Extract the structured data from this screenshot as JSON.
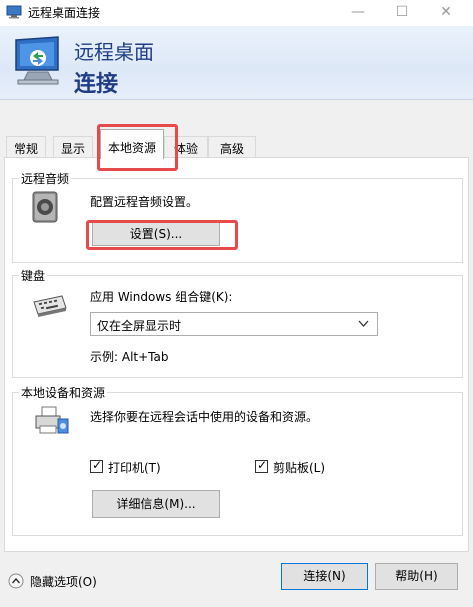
{
  "window": {
    "title": "远程桌面连接",
    "minimize": "—",
    "maximize": "☐",
    "close": "✕"
  },
  "banner": {
    "line1": "远程桌面",
    "line2": "连接"
  },
  "tabs": [
    {
      "label": "常规"
    },
    {
      "label": "显示"
    },
    {
      "label": "本地资源",
      "active": true
    },
    {
      "label": "体验"
    },
    {
      "label": "高级"
    }
  ],
  "audio": {
    "title": "远程音频",
    "description": "配置远程音频设置。",
    "settings_button": "设置(S)..."
  },
  "keyboard": {
    "title": "键盘",
    "label": "应用 Windows 组合键(K):",
    "selected": "仅在全屏显示时",
    "example": "示例: Alt+Tab"
  },
  "devices": {
    "title": "本地设备和资源",
    "description": "选择你要在远程会话中使用的设备和资源。",
    "printer_label": "打印机(T)",
    "printer_checked": true,
    "clipboard_label": "剪贴板(L)",
    "clipboard_checked": true,
    "details_button": "详细信息(M)..."
  },
  "footer": {
    "hide_options": "隐藏选项(O)",
    "connect": "连接(N)",
    "help": "帮助(H)"
  },
  "colors": {
    "highlight": "#e64a4a",
    "banner_text": "#1f3d87",
    "focus": "#0078d7"
  },
  "icons": [
    "remote-desktop-icon",
    "monitor-icon",
    "speaker-icon",
    "keyboard-icon",
    "printer-devices-icon",
    "chevron-down-icon",
    "collapse-up-icon",
    "checkmark-icon"
  ]
}
